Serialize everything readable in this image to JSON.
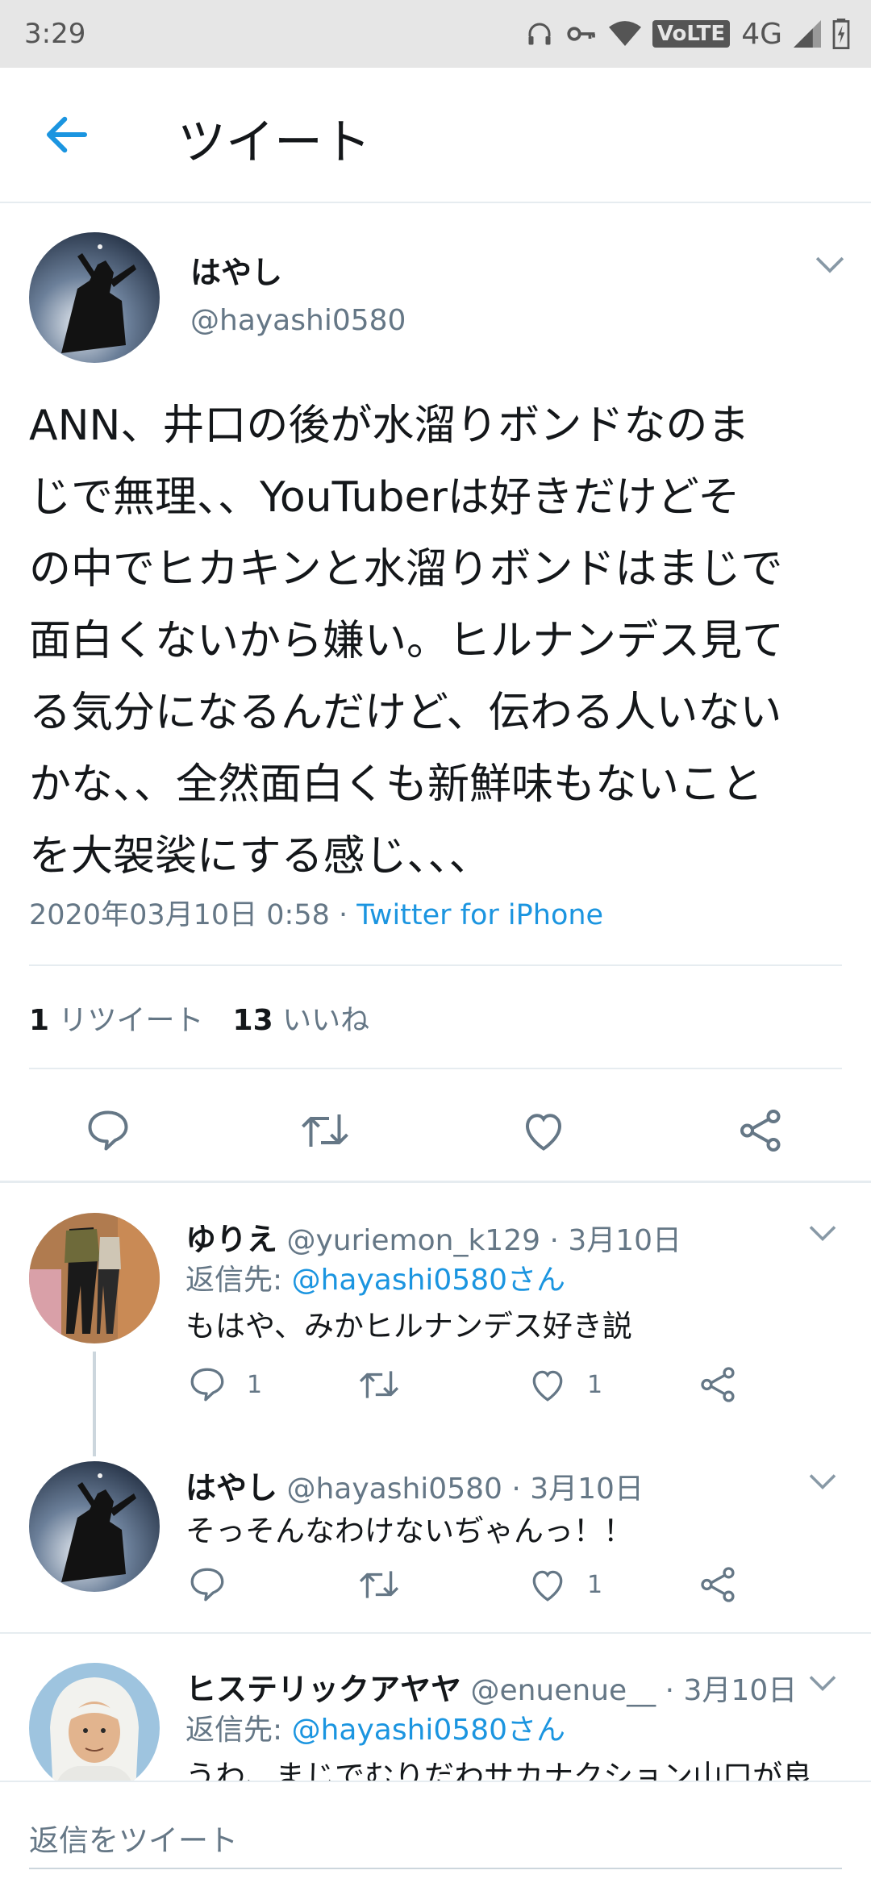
{
  "status_bar": {
    "time": "3:29",
    "icons": [
      "headphones-icon",
      "key-icon",
      "wifi-icon",
      "volte-badge",
      "lte-4g",
      "signal-icon",
      "battery-icon"
    ],
    "volte": "VoLTE",
    "network": "4G"
  },
  "header": {
    "title": "ツイート"
  },
  "tweet": {
    "name": "はやし",
    "handle": "@hayashi0580",
    "text": "ANN、井口の後が水溜りボンドなのまじで無理、、YouTuberは好きだけどその中でヒカキンと水溜りボンドはまじで面白くないから嫌い。ヒルナンデス見てる気分になるんだけど、伝わる人いないかな、、全然面白くも新鮮味もないことを大袈裟にする感じ、、、",
    "lines": [
      "ANN、井口の後が水溜りボンドなのま",
      "じで無理、、YouTuberは好きだけどそ",
      "の中でヒカキンと水溜りボンドはまじで",
      "面白くないから嫌い。ヒルナンデス見て",
      "る気分になるんだけど、伝わる人いない",
      "かな、、全然面白くも新鮮味もないこと",
      "を大袈裟にする感じ、、、"
    ],
    "timestamp": "2020年03月10日 0:58 · ",
    "source": "Twitter for iPhone",
    "retweet_count": "1",
    "retweet_label": "リツイート",
    "like_count": "13",
    "like_label": "いいね"
  },
  "replies": [
    {
      "name": "ゆりえ",
      "handle": "@yuriemon_k129",
      "date": " · 3月10日",
      "reply_to_label": "返信先: ",
      "reply_to": "@hayashi0580さん",
      "text": "もはや、みかヒルナンデス好き説",
      "reply_count": "1",
      "retweet_count": "",
      "like_count": "1"
    },
    {
      "name": "はやし",
      "handle": "@hayashi0580",
      "date": " · 3月10日",
      "text": "そっそんなわけないぢゃんっ！！",
      "reply_count": "",
      "retweet_count": "",
      "like_count": "1"
    },
    {
      "name": "ヒステリックアヤヤ",
      "handle": "@enuenue__",
      "date": " · 3月10日",
      "reply_to_label": "返信先: ",
      "reply_to": "@hayashi0580さん",
      "text": "うわ、まじでむりだわサカナクション山口が良"
    }
  ],
  "composer": {
    "placeholder": "返信をツイート"
  },
  "colors": {
    "accent": "#1b95e0",
    "secondary_text": "#657786",
    "primary_text": "#14171a",
    "divider": "#e6ecf0"
  }
}
